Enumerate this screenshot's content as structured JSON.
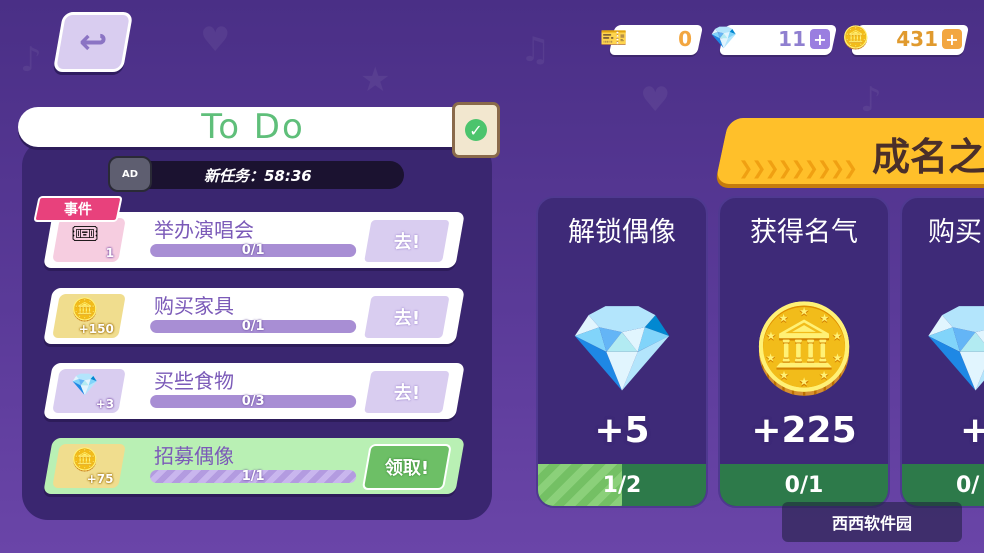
{
  "back": {
    "icon": "back-arrow-icon"
  },
  "currency": {
    "pink": {
      "value": "0",
      "icon": "flower-token-icon"
    },
    "diamond": {
      "value": "11",
      "icon": "diamond-icon"
    },
    "coin": {
      "value": "431",
      "icon": "coin-icon"
    }
  },
  "todo": {
    "title": "To Do",
    "ad_label": "AD",
    "timer": "新任务：58:36",
    "event_tag": "事件",
    "tasks": [
      {
        "name": "举办演唱会",
        "progress": "0/1",
        "reward": "1",
        "button": "去!",
        "fraction": 0
      },
      {
        "name": "购买家具",
        "progress": "0/1",
        "reward": "+150",
        "button": "去!",
        "fraction": 0
      },
      {
        "name": "买些食物",
        "progress": "0/3",
        "reward": "+3",
        "button": "去!",
        "fraction": 0
      },
      {
        "name": "招募偶像",
        "progress": "1/1",
        "reward": "+75",
        "button": "领取!",
        "fraction": 1
      }
    ]
  },
  "goals": {
    "title": "成名之",
    "cards": [
      {
        "title": "解锁偶像",
        "amount": "+5",
        "progress": "1/2",
        "fraction": 0.5
      },
      {
        "title": "获得名气",
        "amount": "+225",
        "progress": "0/1",
        "fraction": 0
      },
      {
        "title": "购买",
        "amount": "+",
        "progress": "0/",
        "fraction": 0
      }
    ]
  },
  "watermark": "西西软件园"
}
